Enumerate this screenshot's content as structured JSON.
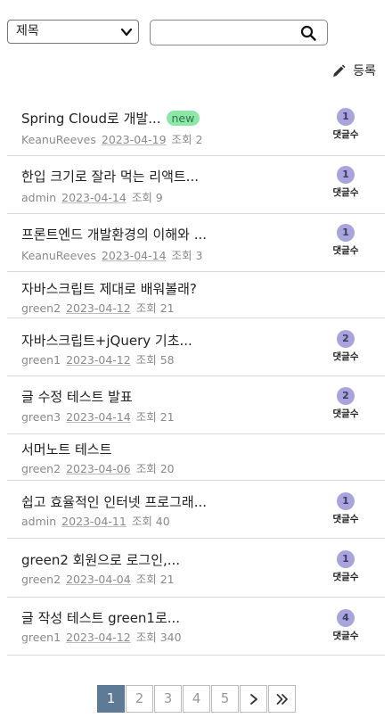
{
  "toolbar": {
    "select_value": "제목",
    "search_value": "",
    "register_label": "등록"
  },
  "posts": [
    {
      "title": "Spring Cloud로 개발...",
      "badge": "new",
      "author": "KeanuReeves",
      "date": "2023-04-19",
      "views": "조회 2",
      "comments": "1",
      "comment_label": "댓글수"
    },
    {
      "title": "한입 크기로 잘라 먹는 리액트...",
      "badge": "",
      "author": "admin",
      "date": "2023-04-14",
      "views": "조회 9",
      "comments": "1",
      "comment_label": "댓글수"
    },
    {
      "title": "프론트엔드 개발환경의 이해와 ...",
      "badge": "",
      "author": "KeanuReeves",
      "date": "2023-04-14",
      "views": "조회 3",
      "comments": "1",
      "comment_label": "댓글수"
    },
    {
      "title": "자바스크립트 제대로 배워볼래?",
      "badge": "",
      "author": "green2",
      "date": "2023-04-12",
      "views": "조회 21",
      "comments": "",
      "comment_label": ""
    },
    {
      "title": "자바스크립트+jQuery 기초...",
      "badge": "",
      "author": "green1",
      "date": "2023-04-12",
      "views": "조회 58",
      "comments": "2",
      "comment_label": "댓글수"
    },
    {
      "title": "글 수정 테스트 발표",
      "badge": "",
      "author": "green3",
      "date": "2023-04-14",
      "views": "조회 21",
      "comments": "2",
      "comment_label": "댓글수"
    },
    {
      "title": "서머노트 테스트",
      "badge": "",
      "author": "green2",
      "date": "2023-04-06",
      "views": "조회 20",
      "comments": "",
      "comment_label": ""
    },
    {
      "title": "쉽고 효율적인 인터넷 프로그래...",
      "badge": "",
      "author": "admin",
      "date": "2023-04-11",
      "views": "조회 40",
      "comments": "1",
      "comment_label": "댓글수"
    },
    {
      "title": "green2 회원으로 로그인,...",
      "badge": "",
      "author": "green2",
      "date": "2023-04-04",
      "views": "조회 21",
      "comments": "1",
      "comment_label": "댓글수"
    },
    {
      "title": "글 작성 테스트 green1로...",
      "badge": "",
      "author": "green1",
      "date": "2023-04-12",
      "views": "조회 340",
      "comments": "4",
      "comment_label": "댓글수"
    }
  ],
  "pagination": {
    "pages": [
      "1",
      "2",
      "3",
      "4",
      "5"
    ],
    "current": "1",
    "icons": [
      "chevron-right-icon",
      "double-chevron-right-icon"
    ]
  },
  "colors": {
    "accent": "#5d7b96",
    "new_badge": "#8ee6a9",
    "comment_circle": "#a9a4db"
  }
}
